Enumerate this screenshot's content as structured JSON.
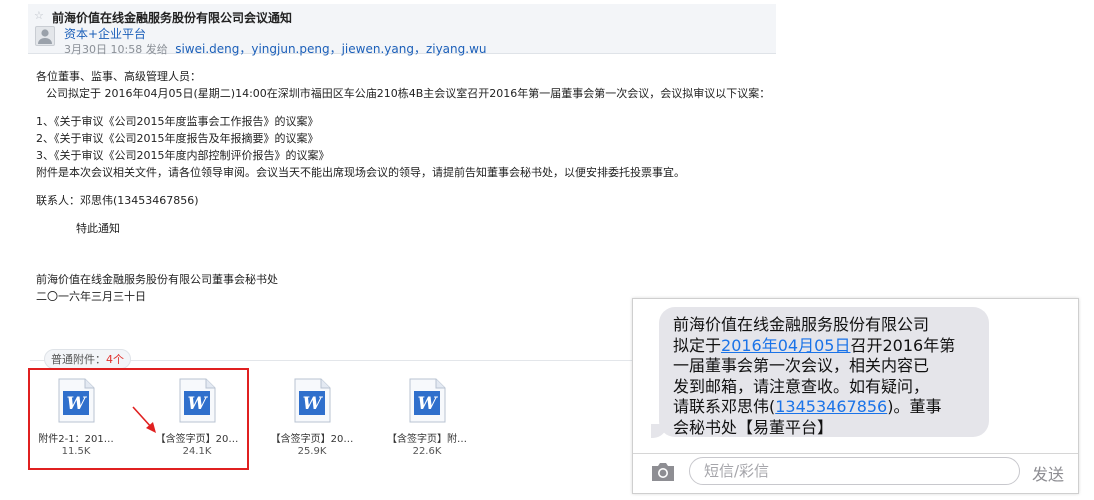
{
  "mail": {
    "subject": "前海价值在线金融服务股份有限公司会议通知",
    "sender": "资本+企业平台",
    "send_time": "3月30日 10:58 发给",
    "recipients": "siwei.deng，yingjun.peng，jiewen.yang，ziyang.wu",
    "body": {
      "salutation": "各位董事、监事、高级管理人员：",
      "intro": "公司拟定于 2016年04月05日(星期二)14:00在深圳市福田区车公庙210栋4B主会议室召开2016年第一届董事会第一次会议，会议拟审议以下议案：",
      "items": [
        "1、《关于审议《公司2015年度监事会工作报告》的议案》",
        "2、《关于审议《公司2015年度报告及年报摘要》的议案》",
        "3、《关于审议《公司2015年度内部控制评价报告》的议案》"
      ],
      "attach_note": "附件是本次会议相关文件，请各位领导审阅。会议当天不能出席现场会议的领导，请提前告知董事会秘书处，以便安排委托投票事宜。",
      "contact": "联系人：邓思伟(13453467856)",
      "closing": "特此通知",
      "signature_org": "前海价值在线金融服务股份有限公司董事会秘书处",
      "signature_date": "二〇一六年三月三十日"
    },
    "attachments_label": "普通附件：",
    "attachments_count": "4个",
    "attachments": [
      {
        "name": "附件2-1：201…",
        "size": "11.5K"
      },
      {
        "name": "【含签字页】20…",
        "size": "24.1K"
      },
      {
        "name": "【含签字页】20…",
        "size": "25.9K"
      },
      {
        "name": "【含签字页】附…",
        "size": "22.6K"
      }
    ]
  },
  "sms": {
    "line1": "前海价值在线金融服务股份有限公司",
    "line2_pre": "拟定于",
    "line2_link": "2016年04月05日",
    "line2_post": "召开2016年第",
    "line3": "一届董事会第一次会议，相关内容已",
    "line4": "发到邮箱，请注意查收。如有疑问，",
    "line5_pre": "请联系邓思伟(",
    "line5_link": "13453467856",
    "line5_post": ")。董事",
    "line6": "会秘书处【易董平台】",
    "input_placeholder": "短信/彩信",
    "send_label": "发送"
  },
  "colors": {
    "link": "#1b5fb9",
    "highlight": "#e02020",
    "sms_link": "#1a73e8",
    "word_icon": "#2f6fcc"
  }
}
